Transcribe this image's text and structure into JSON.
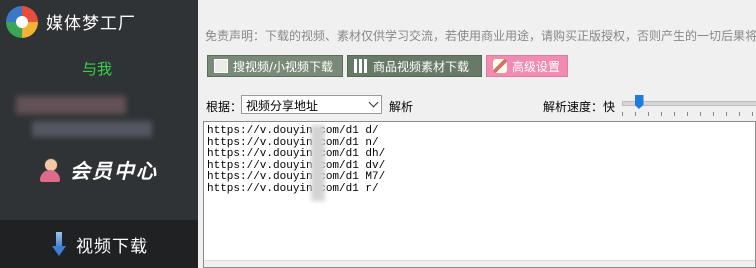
{
  "sidebar": {
    "app_title": "媒体梦工厂",
    "subtitle": "与我",
    "member_center": "会员中心",
    "download_nav": "视频下载"
  },
  "main": {
    "disclaimer": "免责声明：下载的视频、素材仅供学习交流，若使用商业用途，请购买正版授权，否则产生的一切后果将",
    "buttons": [
      {
        "label": "搜视频/小视频下载",
        "icon": "film-icon"
      },
      {
        "label": "商品视频素材下载",
        "icon": "grid-icon"
      },
      {
        "label": "高级设置",
        "icon": "brush-icon"
      }
    ],
    "source_label": "根据：",
    "source_value": "视频分享地址",
    "parse_label": "解析",
    "speed_label": "解析速度：快",
    "speed_level": 0.1,
    "urls": [
      "https://v.douyin.com/d1  d/",
      "https://v.douyin.com/d1  n/",
      "https://v.douyin.com/d1  dh/",
      "https://v.douyin.com/d1  dv/",
      "https://v.douyin.com/d1  M7/",
      "https://v.douyin.com/d1  r/"
    ]
  }
}
